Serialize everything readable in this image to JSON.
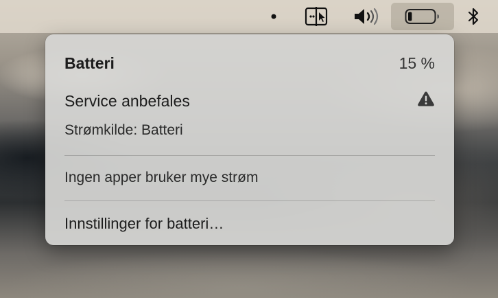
{
  "menubar": {
    "icons": [
      "dot-icon",
      "screen-mirroring-icon",
      "volume-icon",
      "battery-icon",
      "bluetooth-icon"
    ],
    "battery_level": 0.15
  },
  "battery_menu": {
    "title": "Batteri",
    "percent": "15 %",
    "service_text": "Service anbefales",
    "warning_icon": "warning-triangle-icon",
    "power_source": "Strømkilde: Batteri",
    "apps_status": "Ingen apper bruker mye strøm",
    "settings_link": "Innstillinger for batteri…"
  },
  "colors": {
    "panel": "#d6d6d4",
    "menubar": "#e2dace",
    "text": "#1c1c1c"
  }
}
